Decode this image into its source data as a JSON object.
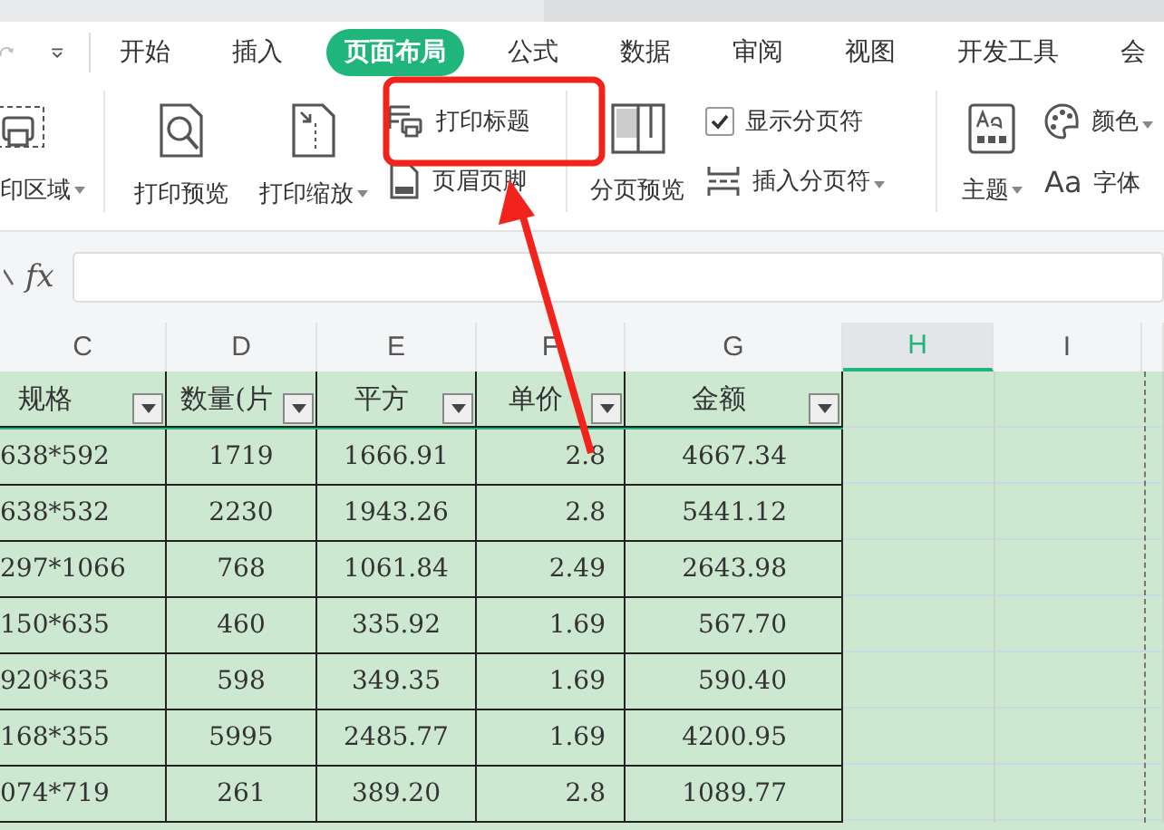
{
  "tabs": [
    {
      "label": "开始",
      "selected": false
    },
    {
      "label": "插入",
      "selected": false
    },
    {
      "label": "页面布局",
      "selected": true
    },
    {
      "label": "公式",
      "selected": false
    },
    {
      "label": "数据",
      "selected": false
    },
    {
      "label": "审阅",
      "selected": false
    },
    {
      "label": "视图",
      "selected": false
    },
    {
      "label": "开发工具",
      "selected": false
    },
    {
      "label": "会",
      "selected": false
    }
  ],
  "ribbon": {
    "print_area": "印区域",
    "print_preview": "打印预览",
    "print_scale": "打印缩放",
    "print_titles": "打印标题",
    "header_footer": "页眉页脚",
    "page_break_preview": "分页预览",
    "show_page_breaks": {
      "label": "显示分页符",
      "checked": true
    },
    "insert_page_break": "插入分页符",
    "theme": "主题",
    "colors": "颜色",
    "fonts_icon": "Aa",
    "fonts": "字体"
  },
  "formula_bar": {
    "fx": "fx"
  },
  "sheet": {
    "columns": [
      {
        "label": "C",
        "selected": false
      },
      {
        "label": "D",
        "selected": false
      },
      {
        "label": "E",
        "selected": false
      },
      {
        "label": "F",
        "selected": false
      },
      {
        "label": "G",
        "selected": false
      },
      {
        "label": "H",
        "selected": true
      },
      {
        "label": "I",
        "selected": false
      }
    ],
    "headers": [
      "规格",
      "数量(片",
      "平方",
      "单价",
      "金额"
    ],
    "rows": [
      [
        "638*592",
        "1719",
        "1666.91",
        "2.8",
        "4667.34"
      ],
      [
        "638*532",
        "2230",
        "1943.26",
        "2.8",
        "5441.12"
      ],
      [
        "297*1066",
        "768",
        "1061.84",
        "2.49",
        "2643.98"
      ],
      [
        "150*635",
        "460",
        "335.92",
        "1.69",
        "567.70"
      ],
      [
        "920*635",
        "598",
        "349.35",
        "1.69",
        "590.40"
      ],
      [
        "168*355",
        "5995",
        "2485.77",
        "1.69",
        "4200.95"
      ],
      [
        "074*719",
        "261",
        "389.20",
        "2.8",
        "1089.77"
      ]
    ]
  }
}
